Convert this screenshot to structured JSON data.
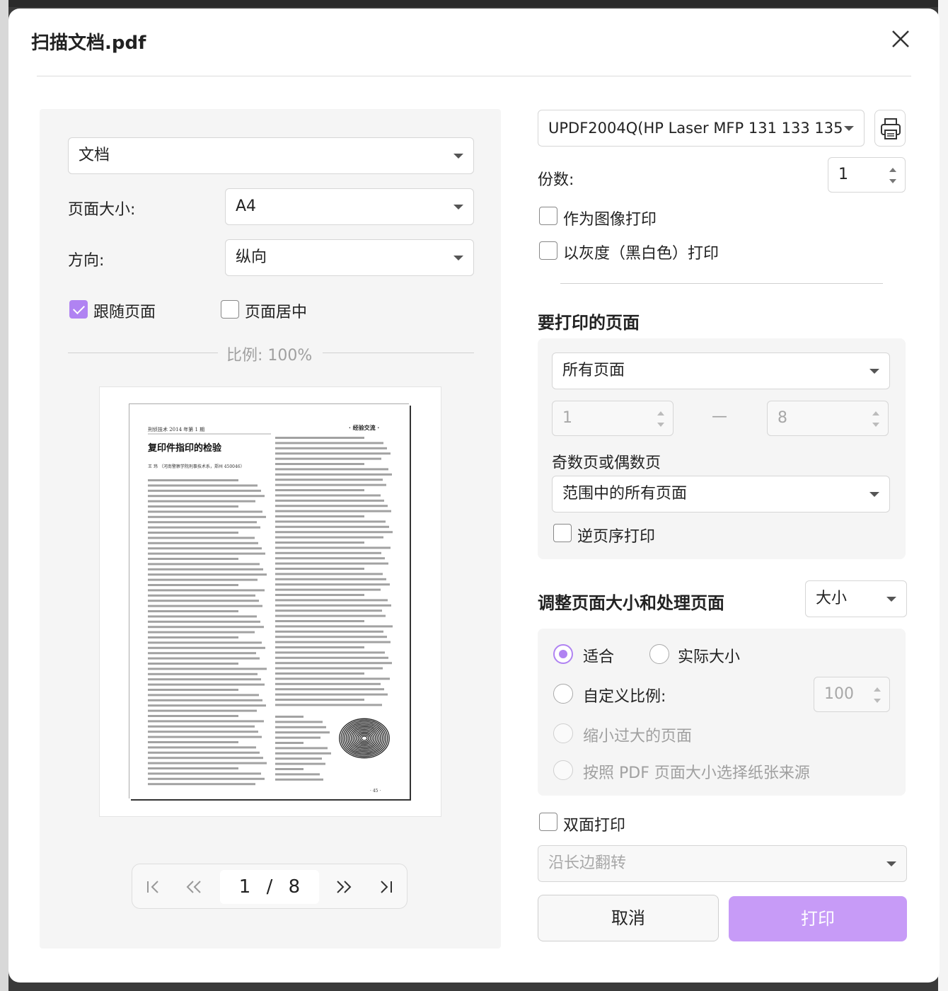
{
  "dialog": {
    "title": "扫描文档.pdf"
  },
  "left": {
    "mode_select": "文档",
    "page_size_label": "页面大小:",
    "page_size_value": "A4",
    "orientation_label": "方向:",
    "orientation_value": "纵向",
    "follow_page_label": "跟随页面",
    "follow_page_checked": true,
    "center_page_label": "页面居中",
    "center_page_checked": false,
    "scale_text": "比例: 100%"
  },
  "pager": {
    "current": "1",
    "separator": "/",
    "total": "8"
  },
  "right": {
    "printer": "UPDF2004Q(HP Laser MFP 131 133 135",
    "copies_label": "份数:",
    "copies_value": "1",
    "print_as_image_label": "作为图像打印",
    "grayscale_label": "以灰度（黑白色）打印",
    "pages_section_title": "要打印的页面",
    "pages_select": "所有页面",
    "range_from": "1",
    "range_dash": "—",
    "range_to": "8",
    "odd_even_label": "奇数页或偶数页",
    "odd_even_select": "范围中的所有页面",
    "reverse_label": "逆页序打印",
    "resize_section_title": "调整页面大小和处理页面",
    "resize_select": "大小",
    "fit_label": "适合",
    "actual_size_label": "实际大小",
    "custom_scale_label": "自定义比例:",
    "custom_scale_value": "100",
    "shrink_label": "缩小过大的页面",
    "paper_source_label": "按照 PDF 页面大小选择纸张来源",
    "duplex_label": "双面打印",
    "flip_select": "沿长边翻转",
    "cancel_button": "取消",
    "print_button": "打印"
  },
  "preview_doc": {
    "header_left": "刑侦技术 2014 年第 1 期",
    "header_right": "· 经验交流 ·",
    "article_title": "复印件指印的检验",
    "author": "王 玮 （河南警察学院刑事技术系，郑州 450046）",
    "page_number": "· 45 ·"
  },
  "colors": {
    "accent": "#b083f2",
    "print_button": "#c79bf7"
  }
}
